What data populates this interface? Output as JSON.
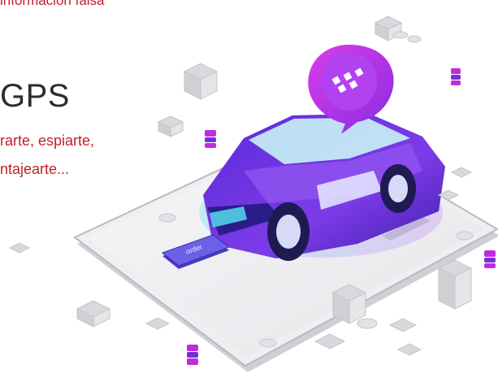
{
  "texts": {
    "top_line": "información falsa",
    "title": "GPS",
    "line1": "rarte, espiarte,",
    "line2": "ntajearte..."
  },
  "phone_button": {
    "label": "order"
  },
  "icons": {
    "pin": "taxi-chat-pin-icon",
    "car": "car-illustration",
    "phone": "smartphone-illustration",
    "button": "order-button-icon"
  },
  "colors": {
    "text_red": "#c0202a",
    "title_dark": "#2d2d2d",
    "accent_purple": "#7a2fd6",
    "accent_magenta": "#c02be0",
    "accent_cyan": "#4fd7e8",
    "gray_cube": "#d7d7db"
  }
}
